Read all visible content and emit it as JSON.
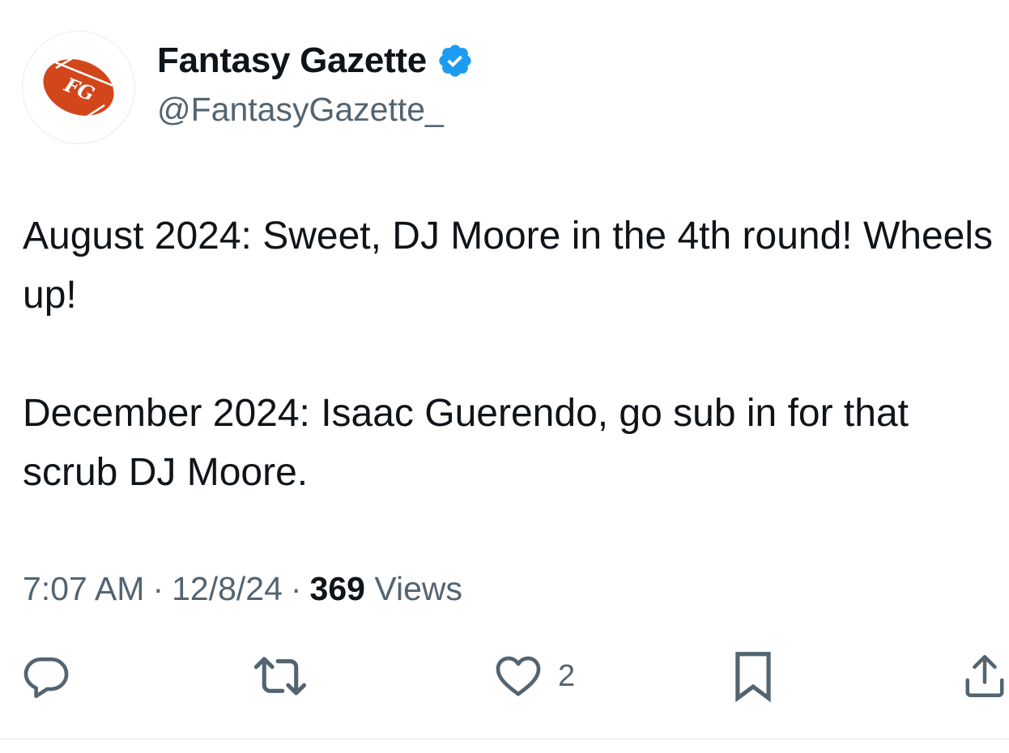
{
  "author": {
    "display_name": "Fantasy Gazette",
    "handle": "@FantasyGazette_",
    "verified": true,
    "avatar_monogram": "FG",
    "avatar_color": "#d2461c",
    "verified_color": "#1d9bf0"
  },
  "tweet": {
    "paragraphs": [
      "August 2024: Sweet, DJ Moore in the 4th round! Wheels up!",
      "December 2024: Isaac Guerendo, go sub in for that scrub DJ Moore."
    ],
    "time": "7:07 AM",
    "date": "12/8/24",
    "separator": "·",
    "views_count": "369",
    "views_label": "Views"
  },
  "actions": {
    "reply": {
      "icon": "reply-icon"
    },
    "retweet": {
      "icon": "retweet-icon"
    },
    "like": {
      "icon": "heart-icon",
      "count": "2"
    },
    "bookmark": {
      "icon": "bookmark-icon"
    },
    "share": {
      "icon": "share-icon"
    }
  }
}
